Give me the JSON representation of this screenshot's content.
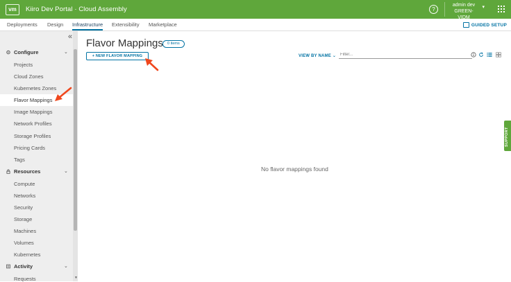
{
  "header": {
    "logo": "vm",
    "title": "Kiiro Dev Portal · Cloud Assembly",
    "help_icon": "?",
    "user_name": "admin dev",
    "user_org": "GREEN-VIDM",
    "color": "#5fa73b"
  },
  "tabs": [
    {
      "label": "Deployments"
    },
    {
      "label": "Design"
    },
    {
      "label": "Infrastructure",
      "active": true
    },
    {
      "label": "Extensibility"
    },
    {
      "label": "Marketplace"
    }
  ],
  "guided_setup": "GUIDED SETUP",
  "sidebar": {
    "collapse_icon": "«",
    "sections": [
      {
        "label": "Configure",
        "icon": "gear-icon",
        "items": [
          "Projects",
          "Cloud Zones",
          "Kubernetes Zones",
          "Flavor Mappings",
          "Image Mappings",
          "Network Profiles",
          "Storage Profiles",
          "Pricing Cards",
          "Tags"
        ]
      },
      {
        "label": "Resources",
        "icon": "lock-icon",
        "items": [
          "Compute",
          "Networks",
          "Security",
          "Storage",
          "Machines",
          "Volumes",
          "Kubernetes"
        ]
      },
      {
        "label": "Activity",
        "icon": "list-icon",
        "items": [
          "Requests"
        ]
      }
    ],
    "active_item": "Flavor Mappings"
  },
  "main": {
    "title": "Flavor Mappings",
    "count_badge": "0 items",
    "new_button": "+ NEW FLAVOR MAPPING",
    "view_by": "VIEW BY NAME ⌄",
    "filter_placeholder": "Filter...",
    "empty_message": "No flavor mappings found"
  },
  "support_tab": "SUPPORT",
  "accent_color": "#0072a3",
  "annotation_color": "#f0471d"
}
